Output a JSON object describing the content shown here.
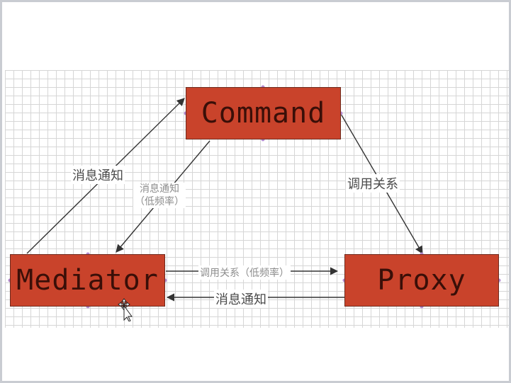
{
  "diagram": {
    "nodes": {
      "command": "Command",
      "mediator": "Mediator",
      "proxy": "Proxy"
    },
    "edges": {
      "mediator_to_command": "消息通知",
      "command_to_mediator_line1": "消息通知",
      "command_to_mediator_line2": "（低频率）",
      "command_to_proxy": "调用关系",
      "mediator_to_proxy": "调用关系（低频率）",
      "proxy_to_mediator": "消息通知"
    }
  },
  "colors": {
    "node_fill": "#c9432b",
    "node_text": "#3a0f08",
    "grid": "#d6d6d6",
    "arrow": "#333333"
  },
  "icons": {
    "cursor": "move-cursor-icon"
  }
}
